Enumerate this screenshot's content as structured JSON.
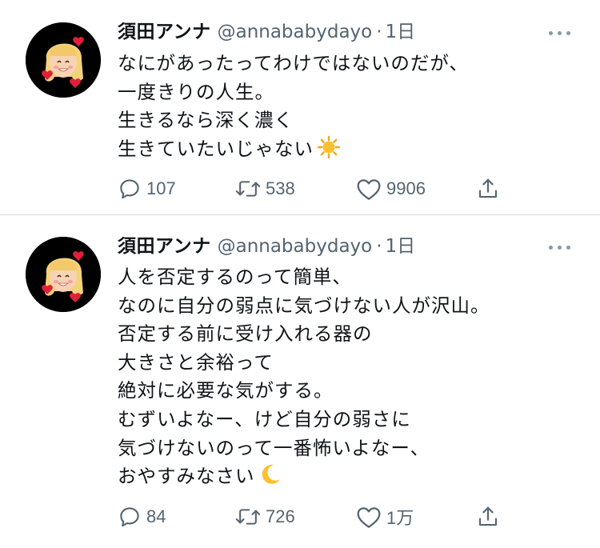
{
  "tweets": [
    {
      "author_name": "須田アンナ",
      "handle": "@annababydayo",
      "dot": "·",
      "time": "1日",
      "lines": [
        "なにがあったってわけではないのだが、",
        "一度きりの人生。",
        "生きるなら深く濃く",
        "生きていたいじゃない"
      ],
      "trailing_emoji": "sun-emoji",
      "replies": "107",
      "retweets": "538",
      "likes": "9906"
    },
    {
      "author_name": "須田アンナ",
      "handle": "@annababydayo",
      "dot": "·",
      "time": "1日",
      "lines": [
        "人を否定するのって簡単、",
        "なのに自分の弱点に気づけない人が沢山。",
        "否定する前に受け入れる器の",
        "大きさと余裕って",
        "絶対に必要な気がする。",
        "むずいよなー、けど自分の弱さに",
        "気づけないのって一番怖いよなー、",
        "おやすみなさい"
      ],
      "trailing_emoji": "crescent-moon-emoji",
      "replies": "84",
      "retweets": "726",
      "likes": "1万"
    }
  ],
  "colors": {
    "text": "#0f1419",
    "secondary": "#536471",
    "divider": "#cfd9de",
    "avatar_bg": "#000000"
  }
}
